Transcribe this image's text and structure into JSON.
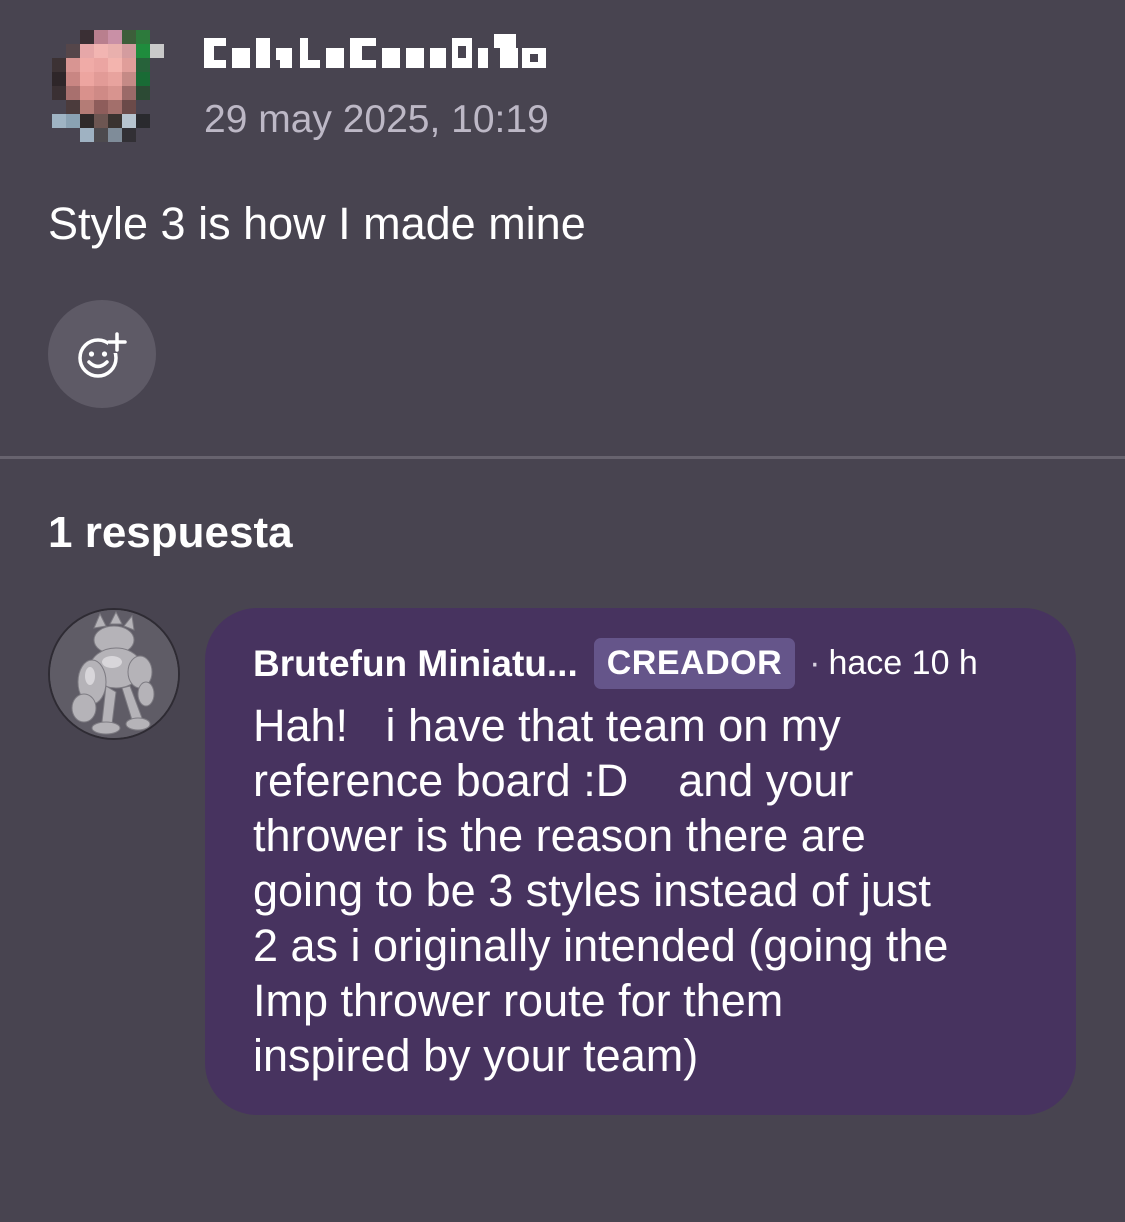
{
  "comment": {
    "timestamp": "29 may 2025, 10:19",
    "text": "Style 3 is how I made mine",
    "react_icon": "smiley-plus-icon"
  },
  "replies": {
    "count_label": "1 respuesta",
    "items": [
      {
        "author": "Brutefun Miniatu...",
        "badge": "CREADOR",
        "separator": "·",
        "time": "hace 10 h",
        "lines": [
          "Hah!   i have that team on my",
          "reference board :D    and your",
          "thrower is the reason there are",
          "going to be 3 styles instead of just",
          "2 as i originally intended (going the",
          "Imp thrower route for them",
          "inspired by your team)"
        ]
      }
    ]
  },
  "colors": {
    "background": "#484450",
    "reply_bubble": "#47335f",
    "creator_badge": "#65558a",
    "muted_text": "#bdb8c6"
  }
}
